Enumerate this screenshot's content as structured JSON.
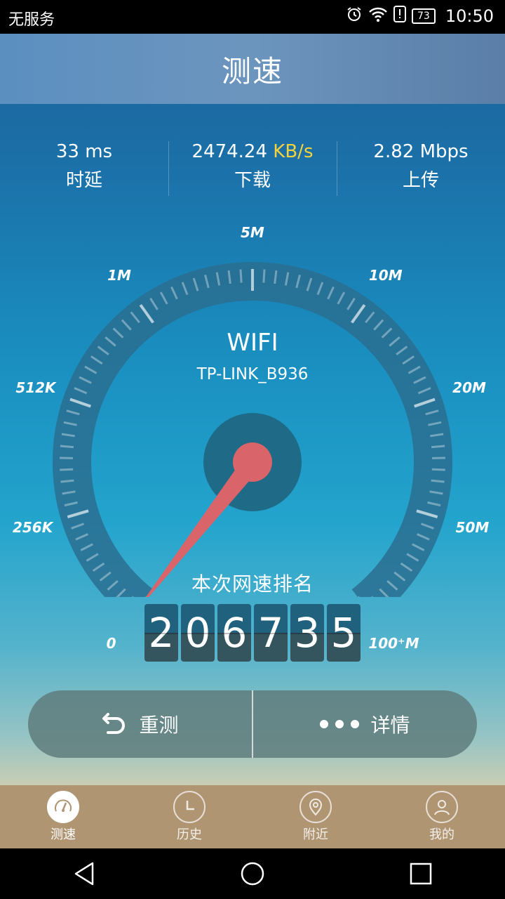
{
  "status_bar": {
    "carrier": "无服务",
    "battery": "73",
    "time": "10:50"
  },
  "header": {
    "title": "测速"
  },
  "stats": [
    {
      "value": "33",
      "unit": "ms",
      "label": "时延"
    },
    {
      "value": "2474.24",
      "unit": "KB/s",
      "label": "下载"
    },
    {
      "value": "2.82",
      "unit": "Mbps",
      "label": "上传"
    }
  ],
  "gauge": {
    "network_type": "WIFI",
    "ssid": "TP-LINK_B936",
    "scale_labels": [
      "0",
      "256K",
      "512K",
      "1M",
      "5M",
      "10M",
      "20M",
      "50M",
      "100⁺M"
    ],
    "needle_fraction": 0.0,
    "colors": {
      "needle": "#d9646a",
      "track": "#2a6f90",
      "hub": "#1f6a86"
    }
  },
  "ranking": {
    "title": "本次网速排名",
    "digits": [
      "2",
      "0",
      "6",
      "7",
      "3",
      "5"
    ]
  },
  "actions": {
    "retest_label": "重测",
    "details_label": "详情"
  },
  "bottom_nav": [
    {
      "label": "测速",
      "icon": "speedometer-icon",
      "active": true
    },
    {
      "label": "历史",
      "icon": "clock-icon",
      "active": false
    },
    {
      "label": "附近",
      "icon": "location-pin-icon",
      "active": false
    },
    {
      "label": "我的",
      "icon": "user-icon",
      "active": false
    }
  ]
}
